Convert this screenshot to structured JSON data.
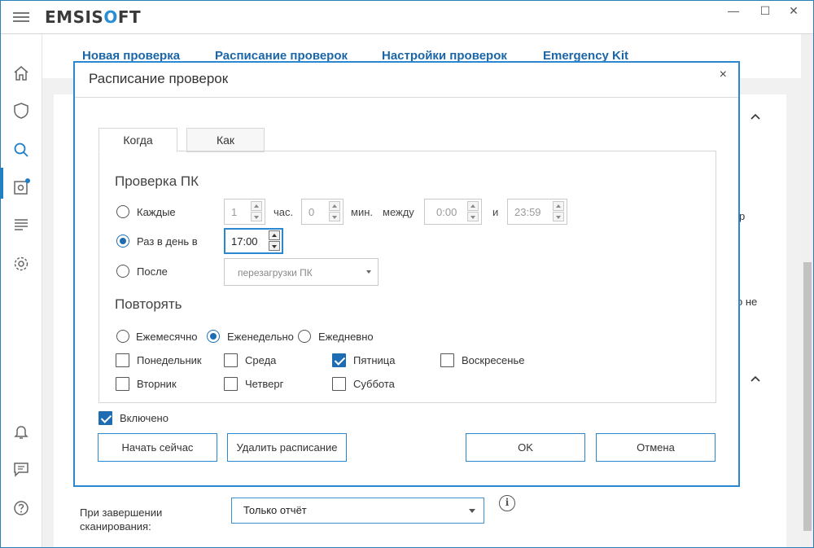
{
  "app": {
    "logo_prefix": "EMSIS",
    "logo_accent": "O",
    "logo_suffix": "FT",
    "accent_color": "#2a8fd2"
  },
  "window": {
    "minimize": "—",
    "maximize": "☐",
    "close": "✕"
  },
  "rail": {
    "items": [
      "home-icon",
      "shield-icon",
      "search-icon",
      "quarantine-icon",
      "logs-icon",
      "settings-icon",
      "bell-icon",
      "chat-icon",
      "help-icon"
    ],
    "active": "search-icon"
  },
  "top_links": [
    "Новая проверка",
    "Расписание проверок",
    "Настройки проверок",
    "Emergency Kit"
  ],
  "background": {
    "side_text_1": "р",
    "side_text_2": "о не"
  },
  "bottom": {
    "label": "При завершении сканирования:",
    "select_value": "Только отчёт",
    "info": "i"
  },
  "dialog": {
    "title": "Расписание проверок",
    "close": "×",
    "tabs": [
      "Когда",
      "Как"
    ],
    "active_tab": "Когда",
    "scan_section": "Проверка ПК",
    "every": {
      "label": "Каждые",
      "hours": "1",
      "hours_unit": "час.",
      "minutes": "0",
      "minutes_unit": "мин.",
      "between": "между",
      "from": "0:00",
      "and": "и",
      "to": "23:59"
    },
    "daily": {
      "label": "Раз в день в",
      "time": "17:00"
    },
    "after": {
      "label": "После",
      "value": "перезагрузки ПК"
    },
    "selected_mode": "daily",
    "repeat_section": "Повторять",
    "repeat_options": [
      "Ежемесячно",
      "Еженедельно",
      "Ежедневно"
    ],
    "repeat_selected": "Еженедельно",
    "days": [
      {
        "label": "Понедельник",
        "checked": false
      },
      {
        "label": "Среда",
        "checked": false
      },
      {
        "label": "Пятница",
        "checked": true
      },
      {
        "label": "Воскресенье",
        "checked": false
      },
      {
        "label": "Вторник",
        "checked": false
      },
      {
        "label": "Четверг",
        "checked": false
      },
      {
        "label": "Суббота",
        "checked": false
      }
    ],
    "enabled": {
      "label": "Включено",
      "checked": true
    },
    "buttons": {
      "start_now": "Начать сейчас",
      "delete": "Удалить расписание",
      "ok": "OK",
      "cancel": "Отмена"
    }
  }
}
